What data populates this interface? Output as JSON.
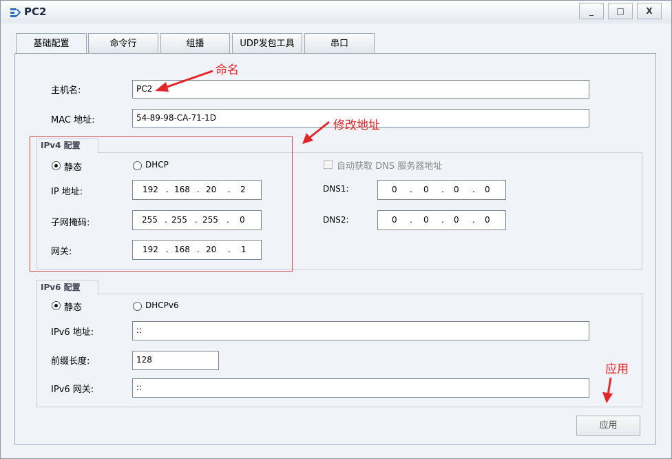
{
  "window": {
    "title": "PC2",
    "minimize": "_",
    "maximize": "□",
    "close": "X"
  },
  "tabs": [
    {
      "label": "基础配置"
    },
    {
      "label": "命令行"
    },
    {
      "label": "组播"
    },
    {
      "label": "UDP发包工具"
    },
    {
      "label": "串口"
    }
  ],
  "basic": {
    "hostname_label": "主机名:",
    "hostname_value": "PC2",
    "mac_label": "MAC 地址:",
    "mac_value": "54-89-98-CA-71-1D"
  },
  "ipv4": {
    "title": "IPv4 配置",
    "static_label": "静态",
    "dhcp_label": "DHCP",
    "ip_label": "IP 地址:",
    "ip": [
      "192",
      "168",
      "20",
      "2"
    ],
    "mask_label": "子网掩码:",
    "mask": [
      "255",
      "255",
      "255",
      "0"
    ],
    "gateway_label": "网关:",
    "gateway": [
      "192",
      "168",
      "20",
      "1"
    ],
    "auto_dns_label": "自动获取 DNS 服务器地址",
    "dns1_label": "DNS1:",
    "dns1": [
      "0",
      "0",
      "0",
      "0"
    ],
    "dns2_label": "DNS2:",
    "dns2": [
      "0",
      "0",
      "0",
      "0"
    ]
  },
  "ipv6": {
    "title": "IPv6 配置",
    "static_label": "静态",
    "dhcp_label": "DHCPv6",
    "ip_label": "IPv6 地址:",
    "ip_value": "::",
    "prefix_label": "前缀长度:",
    "prefix_value": "128",
    "gateway_label": "IPv6 网关:",
    "gateway_value": "::"
  },
  "apply_label": "应用",
  "annotations": {
    "naming": "命名",
    "modify_address": "修改地址",
    "apply": "应用"
  },
  "colors": {
    "annotation": "#e3262b"
  }
}
